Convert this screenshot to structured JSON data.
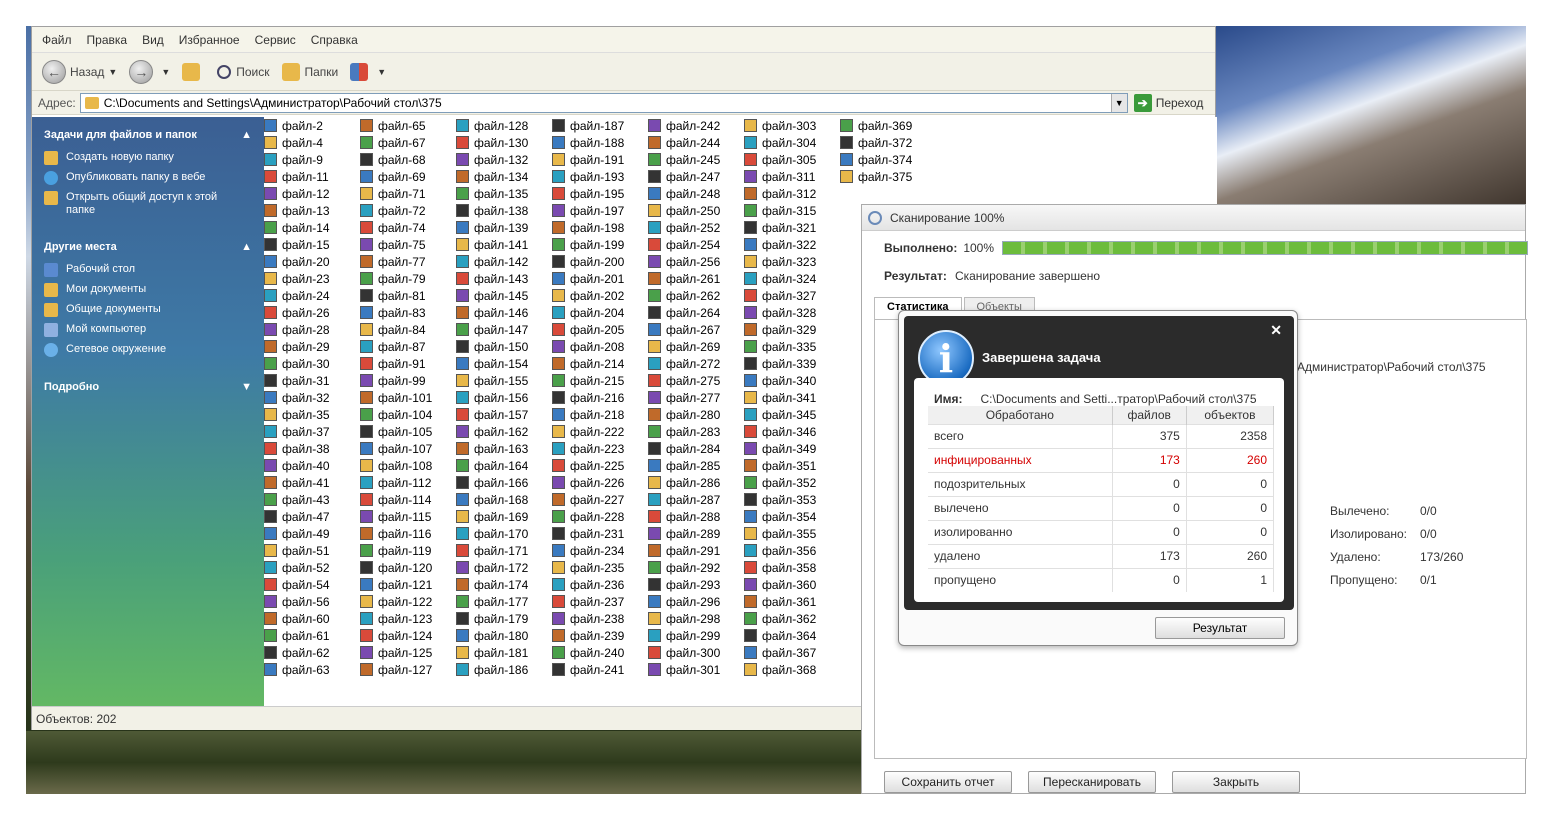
{
  "explorer": {
    "menu": [
      "Файл",
      "Правка",
      "Вид",
      "Избранное",
      "Сервис",
      "Справка"
    ],
    "toolbar": {
      "back": "Назад",
      "search": "Поиск",
      "folders": "Папки"
    },
    "address": {
      "label": "Адрес:",
      "path": "C:\\Documents and Settings\\Администратор\\Рабочий стол\\375",
      "go": "Переход"
    },
    "sidebar": {
      "tasks_title": "Задачи для файлов и папок",
      "tasks": [
        "Создать новую папку",
        "Опубликовать папку в вебе",
        "Открыть общий доступ к этой папке"
      ],
      "places_title": "Другие места",
      "places": [
        "Рабочий стол",
        "Мои документы",
        "Общие документы",
        "Мой компьютер",
        "Сетевое окружение"
      ],
      "details_title": "Подробно"
    },
    "columns": [
      [
        "файл-2",
        "файл-4",
        "файл-9",
        "файл-11",
        "файл-12",
        "файл-13",
        "файл-14",
        "файл-15",
        "файл-20",
        "файл-23",
        "файл-24",
        "файл-26",
        "файл-28",
        "файл-29",
        "файл-30",
        "файл-31",
        "файл-32",
        "файл-35",
        "файл-37",
        "файл-38",
        "файл-40",
        "файл-41",
        "файл-43",
        "файл-47",
        "файл-49",
        "файл-51",
        "файл-52",
        "файл-54",
        "файл-56",
        "файл-60",
        "файл-61",
        "файл-62",
        "файл-63"
      ],
      [
        "файл-65",
        "файл-67",
        "файл-68",
        "файл-69",
        "файл-71",
        "файл-72",
        "файл-74",
        "файл-75",
        "файл-77",
        "файл-79",
        "файл-81",
        "файл-83",
        "файл-84",
        "файл-87",
        "файл-91",
        "файл-99",
        "файл-101",
        "файл-104",
        "файл-105",
        "файл-107",
        "файл-108",
        "файл-112",
        "файл-114",
        "файл-115",
        "файл-116",
        "файл-119",
        "файл-120",
        "файл-121",
        "файл-122",
        "файл-123",
        "файл-124",
        "файл-125",
        "файл-127"
      ],
      [
        "файл-128",
        "файл-130",
        "файл-132",
        "файл-134",
        "файл-135",
        "файл-138",
        "файл-139",
        "файл-141",
        "файл-142",
        "файл-143",
        "файл-145",
        "файл-146",
        "файл-147",
        "файл-150",
        "файл-154",
        "файл-155",
        "файл-156",
        "файл-157",
        "файл-162",
        "файл-163",
        "файл-164",
        "файл-166",
        "файл-168",
        "файл-169",
        "файл-170",
        "файл-171",
        "файл-172",
        "файл-174",
        "файл-177",
        "файл-179",
        "файл-180",
        "файл-181",
        "файл-186"
      ],
      [
        "файл-187",
        "файл-188",
        "файл-191",
        "файл-193",
        "файл-195",
        "файл-197",
        "файл-198",
        "файл-199",
        "файл-200",
        "файл-201",
        "файл-202",
        "файл-204",
        "файл-205",
        "файл-208",
        "файл-214",
        "файл-215",
        "файл-216",
        "файл-218",
        "файл-222",
        "файл-223",
        "файл-225",
        "файл-226",
        "файл-227",
        "файл-228",
        "файл-231",
        "файл-234",
        "файл-235",
        "файл-236",
        "файл-237",
        "файл-238",
        "файл-239",
        "файл-240",
        "файл-241"
      ],
      [
        "файл-242",
        "файл-244",
        "файл-245",
        "файл-247",
        "файл-248",
        "файл-250",
        "файл-252",
        "файл-254",
        "файл-256",
        "файл-261",
        "файл-262",
        "файл-264",
        "файл-267",
        "файл-269",
        "файл-272",
        "файл-275",
        "файл-277",
        "файл-280",
        "файл-283",
        "файл-284",
        "файл-285",
        "файл-286",
        "файл-287",
        "файл-288",
        "файл-289",
        "файл-291",
        "файл-292",
        "файл-293",
        "файл-296",
        "файл-298",
        "файл-299",
        "файл-300",
        "файл-301"
      ],
      [
        "файл-303",
        "файл-304",
        "файл-305",
        "файл-311",
        "файл-312",
        "файл-315",
        "файл-321",
        "файл-322",
        "файл-323",
        "файл-324",
        "файл-327",
        "файл-328",
        "файл-329",
        "файл-335",
        "файл-339",
        "файл-340",
        "файл-341",
        "файл-345",
        "файл-346",
        "файл-349",
        "файл-351",
        "файл-352",
        "файл-353",
        "файл-354",
        "файл-355",
        "файл-356",
        "файл-358",
        "файл-360",
        "файл-361",
        "файл-362",
        "файл-364",
        "файл-367",
        "файл-368"
      ],
      [
        "файл-369",
        "файл-372",
        "файл-374",
        "файл-375"
      ]
    ],
    "status": "Объектов: 202"
  },
  "scan": {
    "title": "Сканирование 100%",
    "done_label": "Выполнено:",
    "done_value": "100%",
    "progress": 1.0,
    "result_label": "Результат:",
    "result_value": "Сканирование завершено",
    "tabs": [
      "Статистика",
      "Объекты"
    ],
    "path_fragment": "Администратор\\Рабочий стол\\375",
    "summary": [
      {
        "label": "Вылечено:",
        "value": "0/0"
      },
      {
        "label": "Изолировано:",
        "value": "0/0"
      },
      {
        "label": "Удалено:",
        "value": "173/260"
      },
      {
        "label": "Пропущено:",
        "value": "0/1"
      }
    ],
    "buttons": [
      "Сохранить отчет",
      "Пересканировать",
      "Закрыть"
    ]
  },
  "popup": {
    "title": "Завершена задача",
    "name_label": "Имя:",
    "name_value": "C:\\Documents and Setti...тратор\\Рабочий стол\\375",
    "headers": [
      "Обработано",
      "файлов",
      "объектов"
    ],
    "rows": [
      {
        "label": "всего",
        "files": "375",
        "objects": "2358"
      },
      {
        "label": "инфицированных",
        "files": "173",
        "objects": "260"
      },
      {
        "label": "подозрительных",
        "files": "0",
        "objects": "0"
      },
      {
        "label": "вылечено",
        "files": "0",
        "objects": "0"
      },
      {
        "label": "изолированно",
        "files": "0",
        "objects": "0"
      },
      {
        "label": "удалено",
        "files": "173",
        "objects": "260"
      },
      {
        "label": "пропущено",
        "files": "0",
        "objects": "1"
      }
    ],
    "button": "Результат"
  }
}
